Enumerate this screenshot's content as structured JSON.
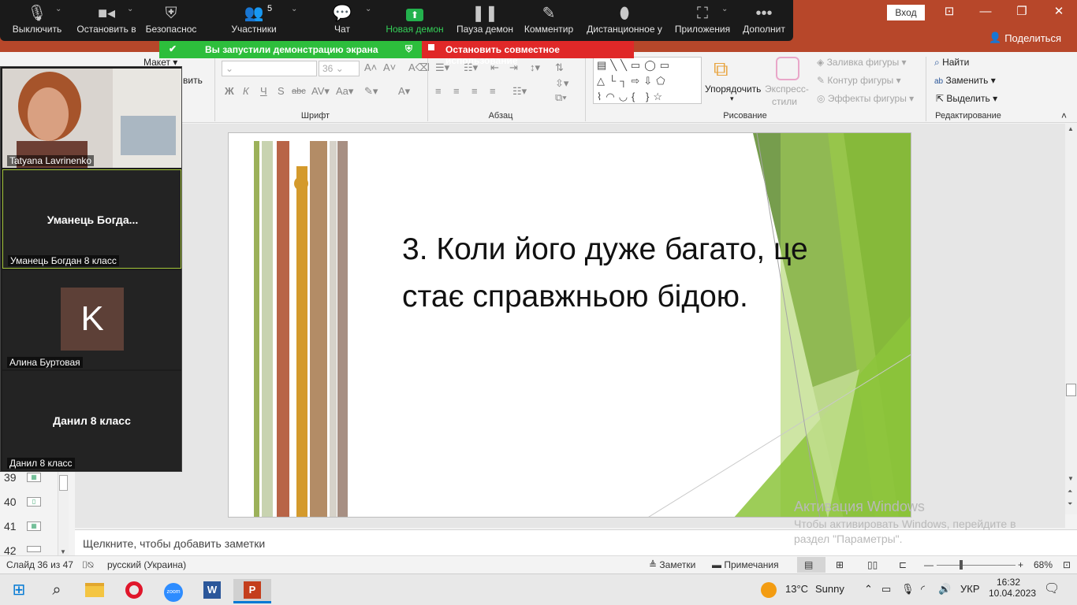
{
  "ppt": {
    "signin": "Вход",
    "share": "Поделиться",
    "ribbon": {
      "font_group": "Шрифт",
      "paragraph_group": "Абзац",
      "drawing_group": "Рисование",
      "editing_group": "Редактирование",
      "font_size": "36",
      "layout": "Макет",
      "arrange": "Упорядочить",
      "quick_styles_1": "Экспресс-",
      "quick_styles_2": "стили",
      "shape_fill": "Заливка фигуры",
      "shape_outline": "Контур фигуры",
      "shape_effects": "Эффекты фигуры",
      "find": "Найти",
      "replace": "Заменить",
      "select": "Выделить",
      "add_partial": "вить"
    },
    "thumbnails": [
      {
        "num": "39"
      },
      {
        "num": "40"
      },
      {
        "num": "41"
      },
      {
        "num": "42"
      }
    ],
    "slide": {
      "text_line1": "3. Коли його дуже багато, це",
      "text_line2": "стає справжньою бідою."
    },
    "notes_placeholder": "Щелкните, чтобы добавить заметки",
    "activation_title": "Активация Windows",
    "activation_line1": "Чтобы активировать Windows, перейдите в",
    "activation_line2": "раздел \"Параметры\".",
    "status": {
      "slide": "Слайд 36 из 47",
      "language": "русский (Украина)",
      "notes": "Заметки",
      "comments": "Примечания",
      "zoom": "68%"
    }
  },
  "zoom_toolbar": {
    "mute": "Выключить",
    "stop_video": "Остановить в",
    "security": "Безопаснос",
    "participants": "Участники",
    "participants_count": "5",
    "chat": "Чат",
    "new_share": "Новая демон",
    "pause_share": "Пауза демон",
    "annotate": "Комментир",
    "remote_control": "Дистанционное у",
    "apps": "Приложения",
    "more": "Дополнит",
    "sharing_banner": "Вы запустили демонстрацию экрана",
    "stop_share": "Остановить совместное использование"
  },
  "participants": [
    {
      "name": "Tatyana Lavrinenko",
      "display": ""
    },
    {
      "name": "Уманець Богдан 8 класс",
      "display": "Уманець  Богда..."
    },
    {
      "name": "Алина Буртовая",
      "display": "",
      "avatar_letter": "K"
    },
    {
      "name": "Данил 8 класс",
      "display": "Данил 8 класс"
    }
  ],
  "taskbar": {
    "weather_temp": "13°C",
    "weather_desc": "Sunny",
    "lang": "УКР",
    "time": "16:32",
    "date": "10.04.2023"
  },
  "colors": {
    "ppt_accent": "#b7472a",
    "zoom_bar": "#1a1a1a",
    "share_green": "#2dbe3c",
    "stop_red": "#e02828",
    "avatar_brown": "#5d4037"
  }
}
